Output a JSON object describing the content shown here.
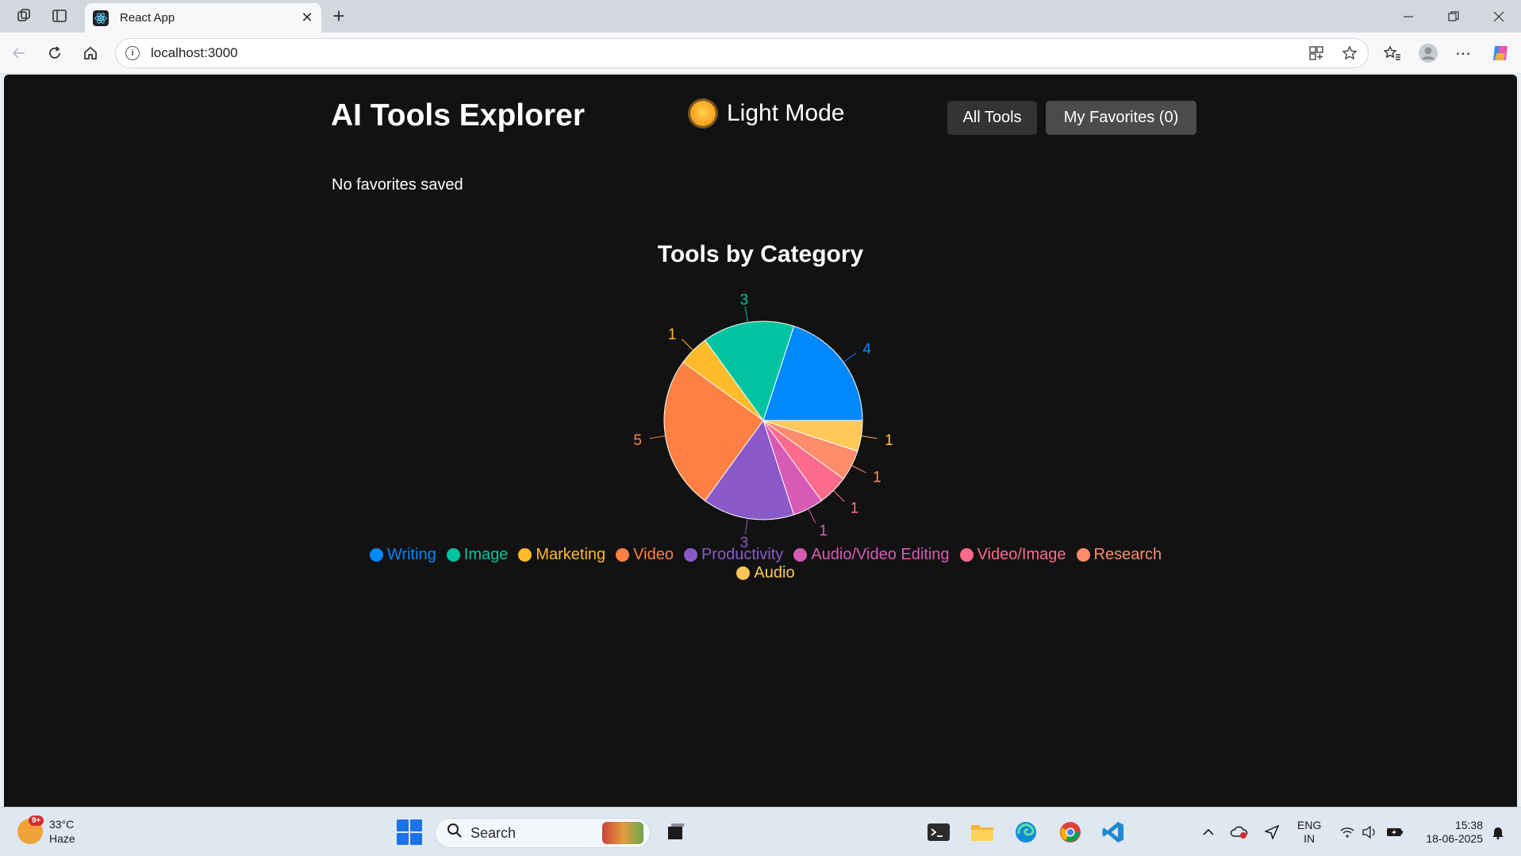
{
  "browser": {
    "tab_title": "React App",
    "url": "localhost:3000"
  },
  "app": {
    "title": "AI Tools Explorer",
    "theme_toggle_label": "Light Mode",
    "nav": {
      "all_tools": "All Tools",
      "my_favorites": "My Favorites (0)"
    },
    "favorites_empty_text": "No favorites saved"
  },
  "chart_data": {
    "type": "pie",
    "title": "Tools by Category",
    "categories": [
      "Writing",
      "Image",
      "Marketing",
      "Video",
      "Productivity",
      "Audio/Video Editing",
      "Video/Image",
      "Research",
      "Audio"
    ],
    "values": [
      4,
      3,
      1,
      5,
      3,
      1,
      1,
      1,
      1
    ],
    "colors": [
      "#0088FE",
      "#00C49F",
      "#FFBB28",
      "#FF8042",
      "#8A5AC8",
      "#D95AB5",
      "#FF6B8A",
      "#FF8C6A",
      "#FFC658"
    ],
    "legend_position": "bottom",
    "show_value_labels": true
  },
  "taskbar": {
    "weather_temp": "33°C",
    "weather_desc": "Haze",
    "weather_badge": "9+",
    "search_placeholder": "Search",
    "lang_line1": "ENG",
    "lang_line2": "IN",
    "time": "15:38",
    "date": "18-06-2025"
  }
}
